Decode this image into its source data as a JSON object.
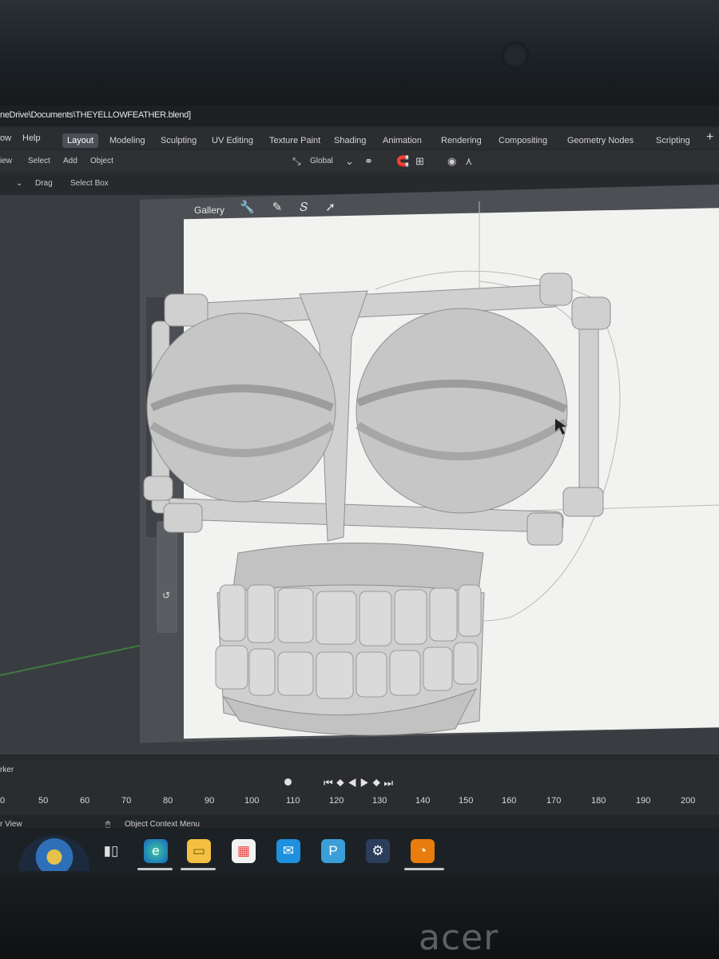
{
  "title_bar": {
    "path": "neDrive\\Documents\\THEYELLOWFEATHER.blend]"
  },
  "menu": {
    "items": [
      "ow",
      "Help"
    ]
  },
  "workspace_tabs": [
    "Layout",
    "Modeling",
    "Sculpting",
    "UV Editing",
    "Texture Paint",
    "Shading",
    "Animation",
    "Rendering",
    "Compositing",
    "Geometry Nodes",
    "Scripting"
  ],
  "active_tab": "Layout",
  "header": {
    "view": "iew",
    "select": "Select",
    "add": "Add",
    "object": "Object",
    "transform_orientation": "Global",
    "drag_label": "Drag",
    "select_box": "Select Box"
  },
  "reference": {
    "label": "Gallery"
  },
  "timeline": {
    "marker_label": "rker",
    "frames": [
      "0",
      "50",
      "60",
      "70",
      "80",
      "90",
      "100",
      "110",
      "120",
      "130",
      "140",
      "150",
      "160",
      "170",
      "180",
      "190",
      "200"
    ]
  },
  "status": {
    "left": "r View",
    "context": "Object Context Menu"
  },
  "taskbar": {
    "icons": [
      "task-view-icon",
      "edge-icon",
      "file-explorer-icon",
      "store-icon",
      "mail-icon",
      "publisher-icon",
      "steam-icon",
      "blender-icon"
    ]
  },
  "laptop": {
    "brand": "acer"
  },
  "colors": {
    "accent_active_tab": "#4b4f55",
    "viewport": "#393c40",
    "reference_bg": "#f2f2f0",
    "model": "#c9c9c9"
  }
}
